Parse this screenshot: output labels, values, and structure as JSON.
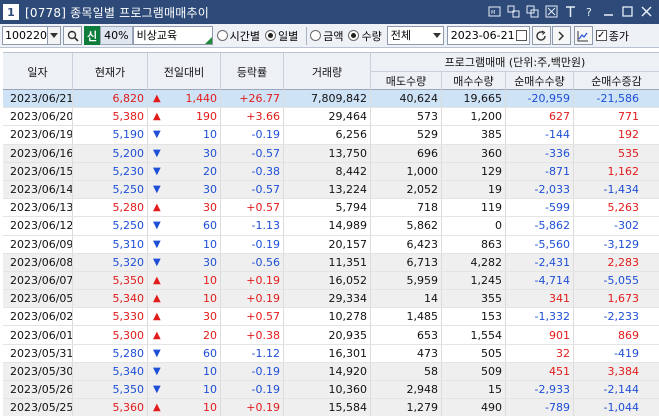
{
  "window": {
    "number": "1",
    "title": "[0778] 종목일별 프로그램매매추이",
    "buttons": [
      "CMD",
      "link",
      "copy",
      "close-x",
      "font",
      "help",
      "minimize",
      "maximize",
      "close"
    ]
  },
  "toolbar": {
    "code": "100220",
    "badge": "신",
    "percent": "40%",
    "stock_name": "비상교육",
    "radio_time": "시간별",
    "radio_day": "일별",
    "radio_amount": "금액",
    "radio_qty": "수량",
    "market_select": "전체",
    "date": "2023-06-21",
    "check_label": "종가"
  },
  "table": {
    "headers": {
      "date": "일자",
      "price": "현재가",
      "change": "전일대비",
      "rate": "등락률",
      "volume": "거래량",
      "program_group": "프로그램매매 (단위:주,백만원)",
      "sell": "매도수량",
      "buy": "매수수량",
      "net": "순매수수량",
      "net_change": "순매수증감"
    },
    "rows": [
      {
        "date": "2023/06/21",
        "price": "6,820",
        "dir": "up",
        "change": "1,440",
        "rate": "+26.77",
        "volume": "7,809,842",
        "sell": "40,624",
        "buy": "19,665",
        "net": "-20,959",
        "net_change": "-21,586"
      },
      {
        "date": "2023/06/20",
        "price": "5,380",
        "dir": "up",
        "change": "190",
        "rate": "+3.66",
        "volume": "29,464",
        "sell": "573",
        "buy": "1,200",
        "net": "627",
        "net_change": "771"
      },
      {
        "date": "2023/06/19",
        "price": "5,190",
        "dir": "down",
        "change": "10",
        "rate": "-0.19",
        "volume": "6,256",
        "sell": "529",
        "buy": "385",
        "net": "-144",
        "net_change": "192"
      },
      {
        "date": "2023/06/16",
        "price": "5,200",
        "dir": "down",
        "change": "30",
        "rate": "-0.57",
        "volume": "13,750",
        "sell": "696",
        "buy": "360",
        "net": "-336",
        "net_change": "535"
      },
      {
        "date": "2023/06/15",
        "price": "5,230",
        "dir": "down",
        "change": "20",
        "rate": "-0.38",
        "volume": "8,442",
        "sell": "1,000",
        "buy": "129",
        "net": "-871",
        "net_change": "1,162"
      },
      {
        "date": "2023/06/14",
        "price": "5,250",
        "dir": "down",
        "change": "30",
        "rate": "-0.57",
        "volume": "13,224",
        "sell": "2,052",
        "buy": "19",
        "net": "-2,033",
        "net_change": "-1,434"
      },
      {
        "date": "2023/06/13",
        "price": "5,280",
        "dir": "up",
        "change": "30",
        "rate": "+0.57",
        "volume": "5,794",
        "sell": "718",
        "buy": "119",
        "net": "-599",
        "net_change": "5,263"
      },
      {
        "date": "2023/06/12",
        "price": "5,250",
        "dir": "down",
        "change": "60",
        "rate": "-1.13",
        "volume": "14,989",
        "sell": "5,862",
        "buy": "0",
        "net": "-5,862",
        "net_change": "-302"
      },
      {
        "date": "2023/06/09",
        "price": "5,310",
        "dir": "down",
        "change": "10",
        "rate": "-0.19",
        "volume": "20,157",
        "sell": "6,423",
        "buy": "863",
        "net": "-5,560",
        "net_change": "-3,129"
      },
      {
        "date": "2023/06/08",
        "price": "5,320",
        "dir": "down",
        "change": "30",
        "rate": "-0.56",
        "volume": "11,351",
        "sell": "6,713",
        "buy": "4,282",
        "net": "-2,431",
        "net_change": "2,283"
      },
      {
        "date": "2023/06/07",
        "price": "5,350",
        "dir": "up",
        "change": "10",
        "rate": "+0.19",
        "volume": "16,052",
        "sell": "5,959",
        "buy": "1,245",
        "net": "-4,714",
        "net_change": "-5,055"
      },
      {
        "date": "2023/06/05",
        "price": "5,340",
        "dir": "up",
        "change": "10",
        "rate": "+0.19",
        "volume": "29,334",
        "sell": "14",
        "buy": "355",
        "net": "341",
        "net_change": "1,673"
      },
      {
        "date": "2023/06/02",
        "price": "5,330",
        "dir": "up",
        "change": "30",
        "rate": "+0.57",
        "volume": "10,278",
        "sell": "1,485",
        "buy": "153",
        "net": "-1,332",
        "net_change": "-2,233"
      },
      {
        "date": "2023/06/01",
        "price": "5,300",
        "dir": "up",
        "change": "20",
        "rate": "+0.38",
        "volume": "20,935",
        "sell": "653",
        "buy": "1,554",
        "net": "901",
        "net_change": "869"
      },
      {
        "date": "2023/05/31",
        "price": "5,280",
        "dir": "down",
        "change": "60",
        "rate": "-1.12",
        "volume": "16,301",
        "sell": "473",
        "buy": "505",
        "net": "32",
        "net_change": "-419"
      },
      {
        "date": "2023/05/30",
        "price": "5,340",
        "dir": "down",
        "change": "10",
        "rate": "-0.19",
        "volume": "14,920",
        "sell": "58",
        "buy": "509",
        "net": "451",
        "net_change": "3,384"
      },
      {
        "date": "2023/05/26",
        "price": "5,350",
        "dir": "down",
        "change": "10",
        "rate": "-0.19",
        "volume": "10,360",
        "sell": "2,948",
        "buy": "15",
        "net": "-2,933",
        "net_change": "-2,144"
      },
      {
        "date": "2023/05/25",
        "price": "5,360",
        "dir": "up",
        "change": "10",
        "rate": "+0.19",
        "volume": "15,584",
        "sell": "1,279",
        "buy": "490",
        "net": "-789",
        "net_change": "-1,044"
      }
    ]
  },
  "colors": {
    "up": "#e21b1b",
    "down": "#1e4fd6",
    "title_bar": "#2d4a78",
    "selected_row": "#cfe3f7"
  }
}
